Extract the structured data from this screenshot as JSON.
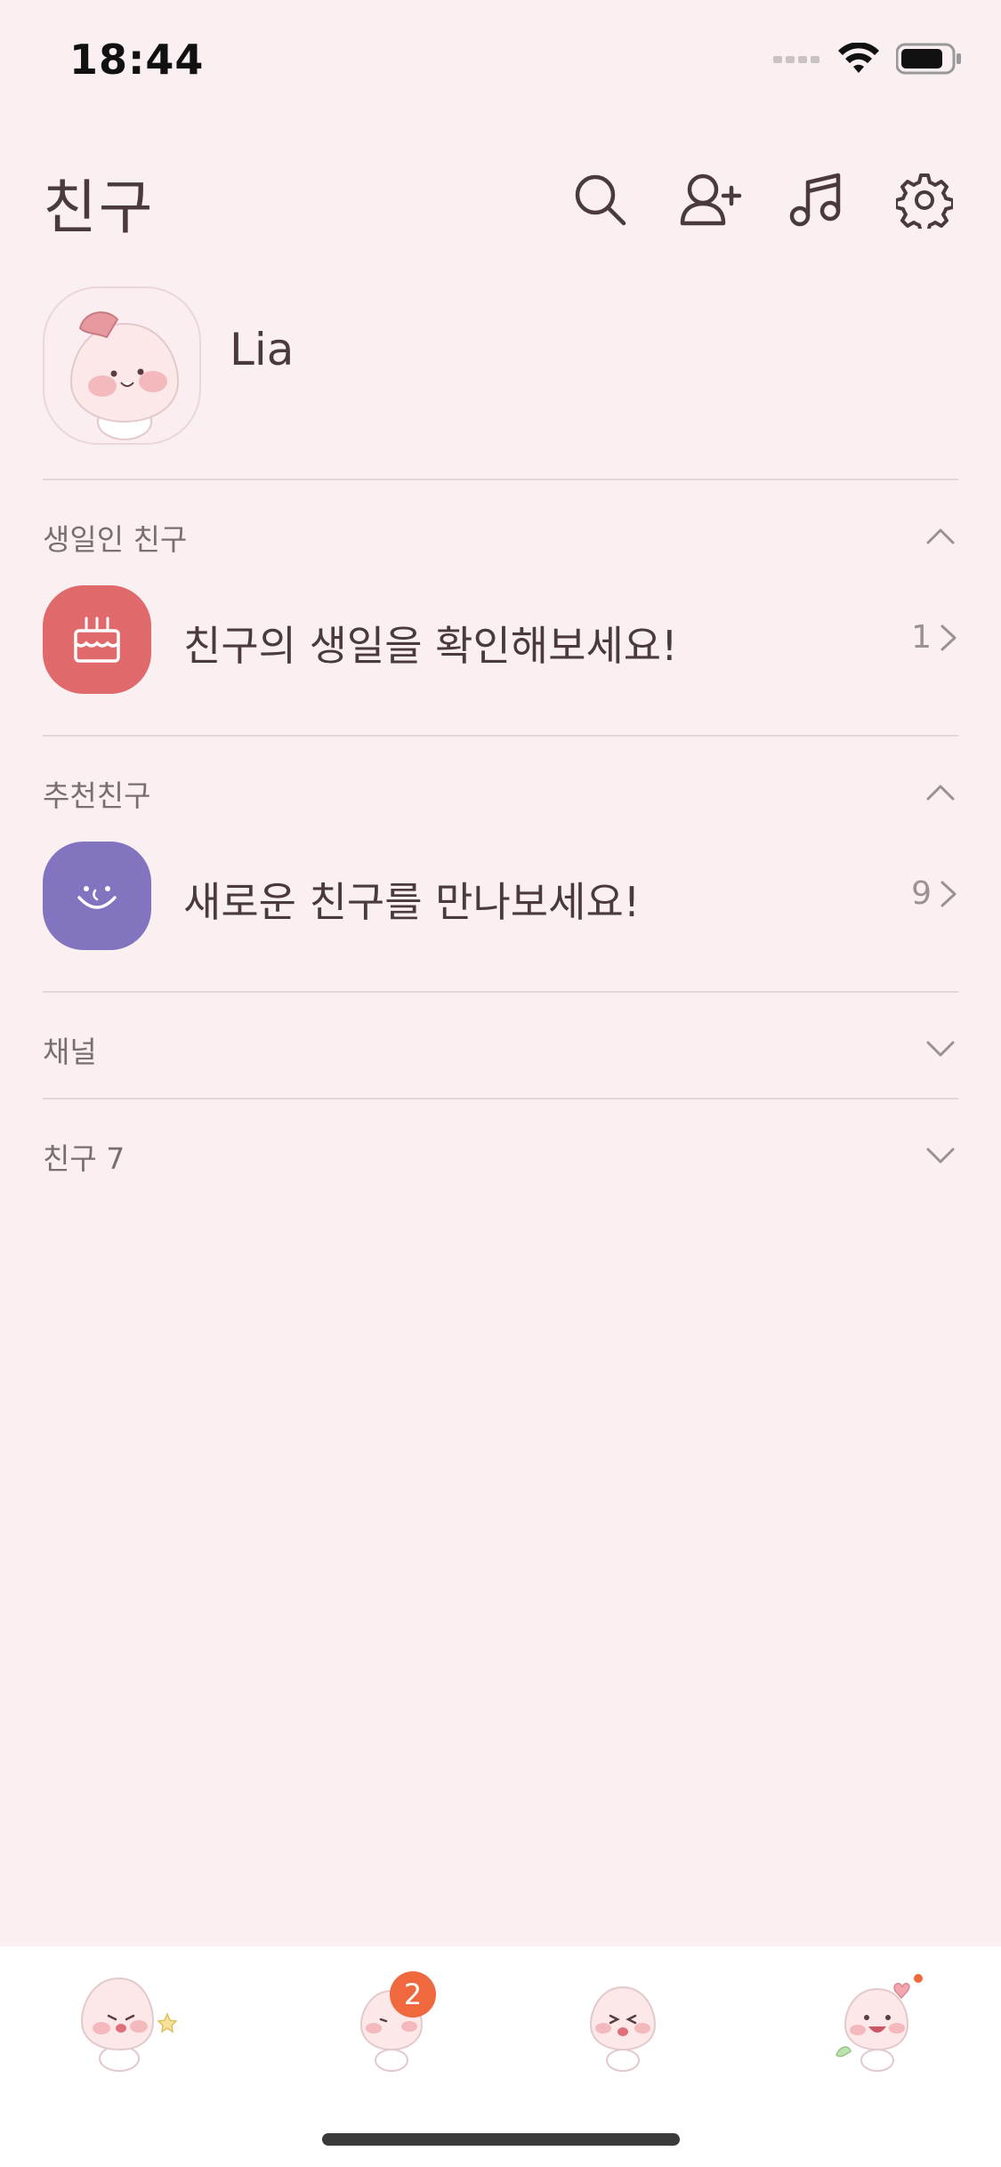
{
  "status": {
    "time": "18:44"
  },
  "header": {
    "title": "친구",
    "icons": [
      "search-icon",
      "add-friend-icon",
      "music-icon",
      "settings-icon"
    ]
  },
  "profile": {
    "name": "Lia"
  },
  "sections": {
    "birthday": {
      "label": "생일인 친구",
      "row_text": "친구의 생일을 확인해보세요!",
      "count": "1"
    },
    "recommended": {
      "label": "추천친구",
      "row_text": "새로운 친구를 만나보세요!",
      "count": "9"
    },
    "channel": {
      "label": "채널"
    },
    "friends": {
      "label": "친구 7"
    }
  },
  "tabbar": {
    "tabs": [
      "friends-tab",
      "chats-tab",
      "view-tab",
      "more-tab"
    ],
    "chats_badge": "2"
  },
  "colors": {
    "background": "#fbf0f1",
    "birthday_icon_bg": "#e0696b",
    "recommend_icon_bg": "#8374c0",
    "badge": "#f0683e"
  }
}
